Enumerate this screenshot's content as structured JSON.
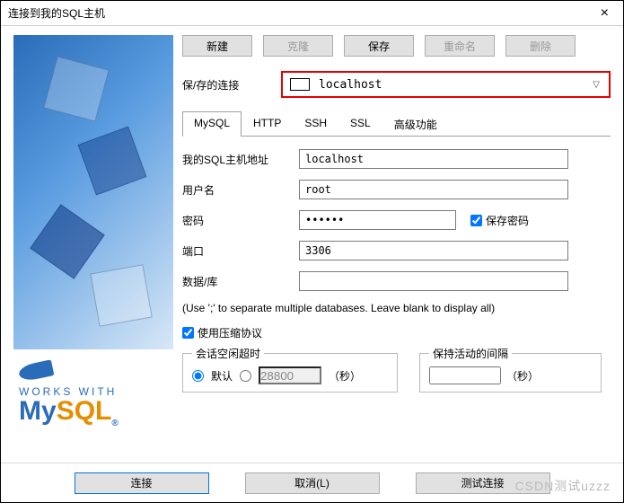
{
  "window": {
    "title": "连接到我的SQL主机",
    "close": "×"
  },
  "toolbar": {
    "new": "新建",
    "clone": "克隆",
    "save": "保存",
    "rename": "重命名",
    "delete": "删除"
  },
  "saved": {
    "label": "保/存的连接",
    "selected": "localhost"
  },
  "tabs": {
    "mysql": "MySQL",
    "http": "HTTP",
    "ssh": "SSH",
    "ssl": "SSL",
    "advanced": "高级功能"
  },
  "form": {
    "host_label": "我的SQL主机地址",
    "host_value": "localhost",
    "user_label": "用户名",
    "user_value": "root",
    "pass_label": "密码",
    "pass_value": "••••••",
    "save_pass_label": "保存密码",
    "port_label": "端口",
    "port_value": "3306",
    "db_label": "数据/库",
    "db_value": "",
    "hint": "(Use ';' to separate multiple databases. Leave blank to display all)",
    "compress_label": "使用压缩协议"
  },
  "idle": {
    "legend": "会话空闲超时",
    "default_label": "默认",
    "custom_value": "28800",
    "seconds": "（秒）"
  },
  "keepalive": {
    "legend": "保持活动的间隔",
    "value": "",
    "seconds": "（秒）"
  },
  "logo": {
    "works_with": "WORKS WITH",
    "mysql_my": "My",
    "mysql_sql": "SQL"
  },
  "footer": {
    "connect": "连接",
    "cancel": "取消(L)",
    "test": "测试连接"
  },
  "watermark": "CSDN测试uzzz"
}
